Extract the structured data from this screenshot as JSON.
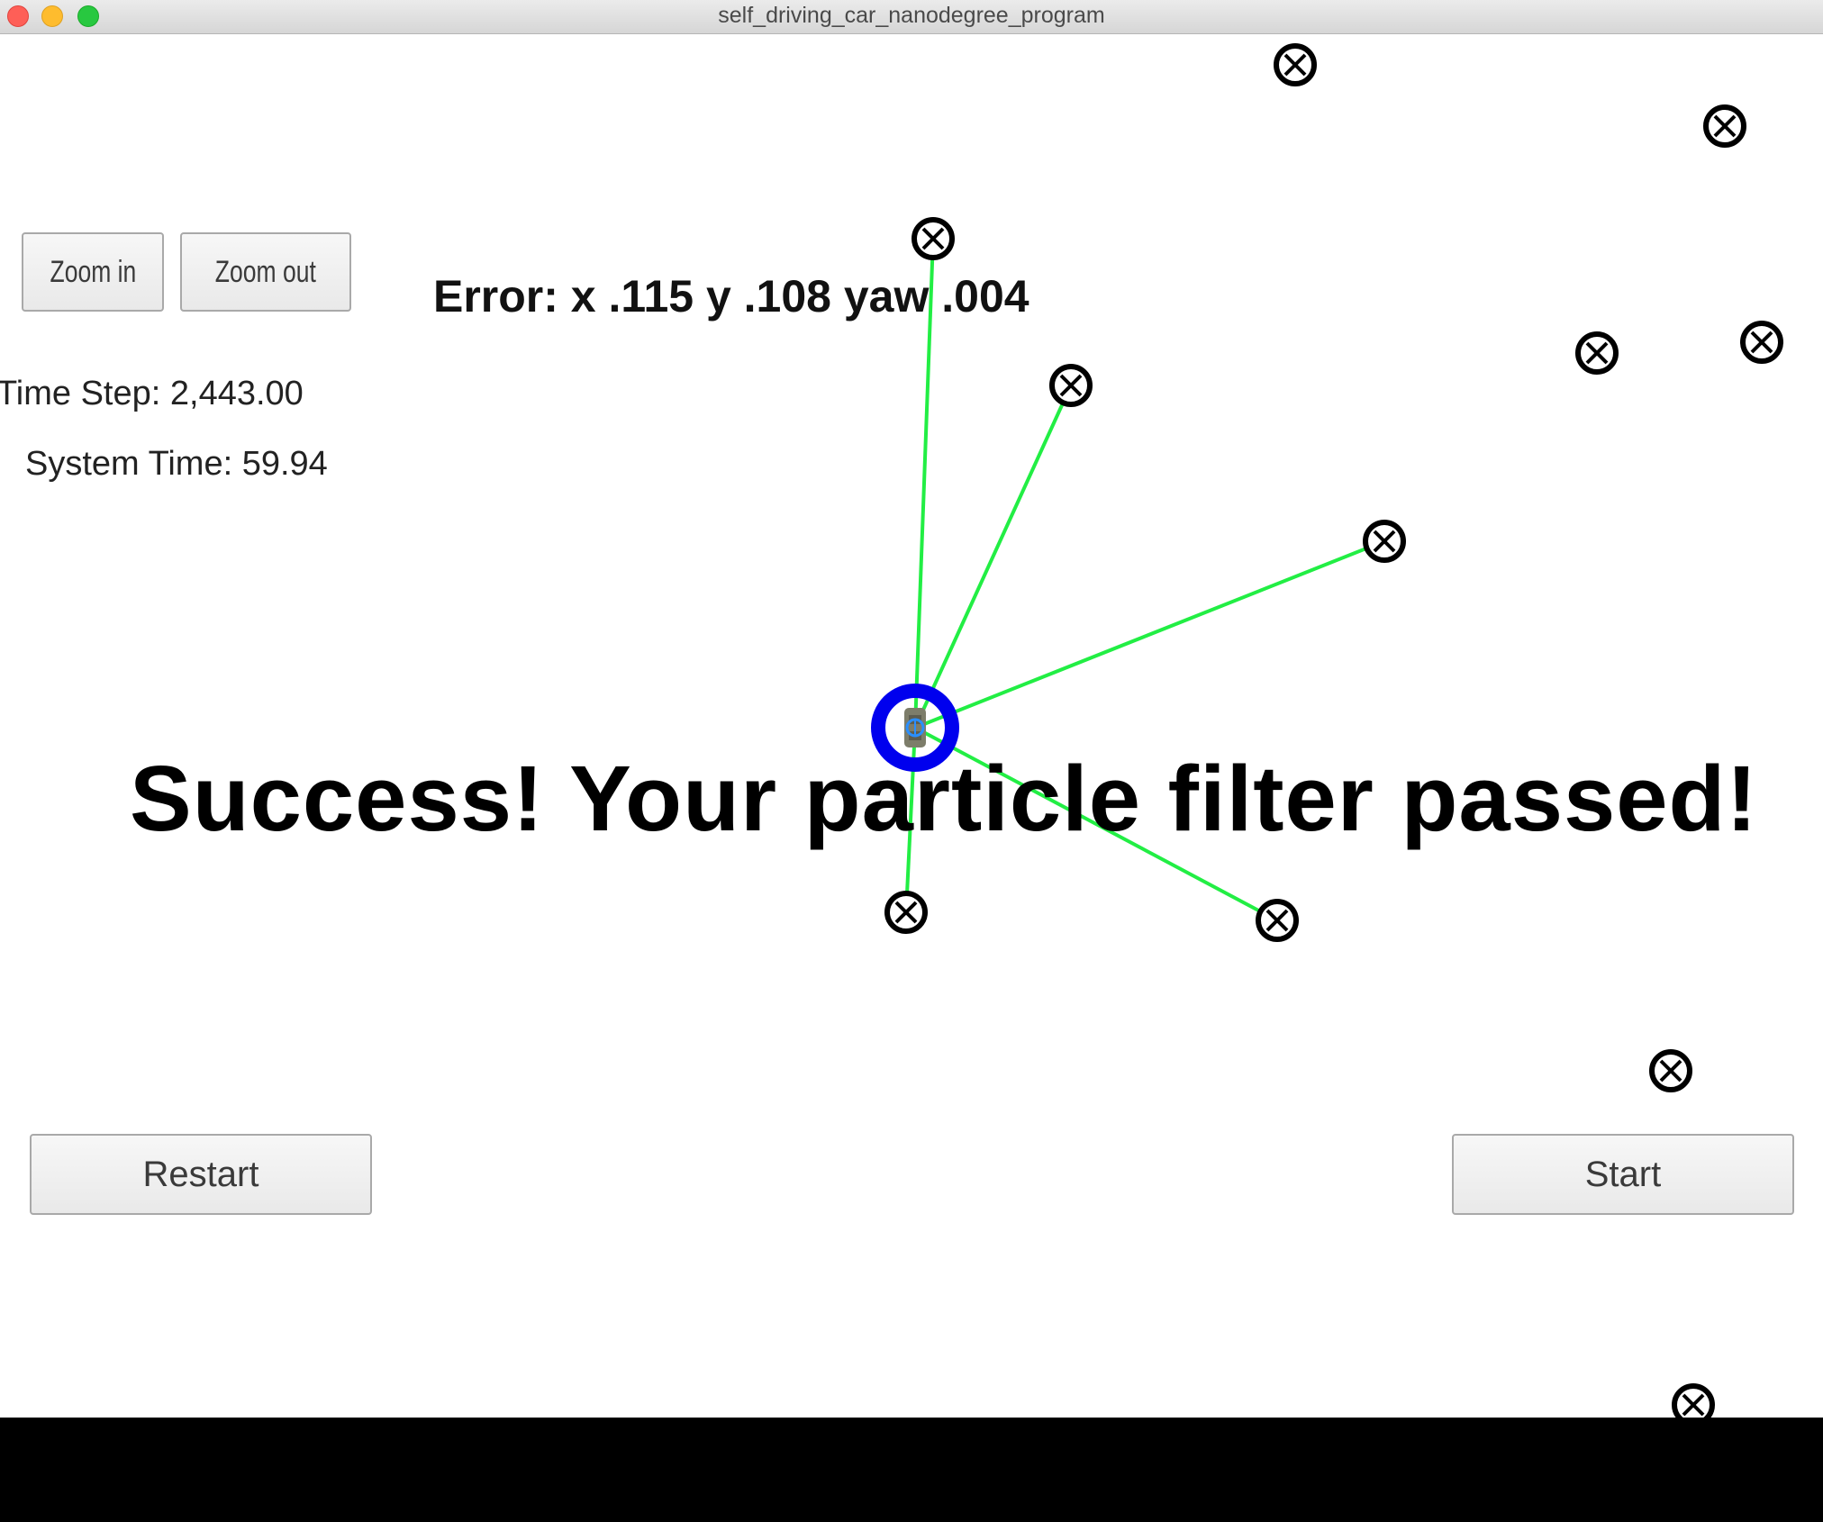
{
  "window": {
    "title": "self_driving_car_nanodegree_program"
  },
  "controls": {
    "zoom_in_label": "Zoom in",
    "zoom_out_label": "Zoom out",
    "restart_label": "Restart",
    "start_label": "Start"
  },
  "stats": {
    "time_step": "Time Step: 2,443.00",
    "system_time": "System Time: 59.94"
  },
  "error_readout": "Error: x .115 y .108 yaw .004",
  "status_message": "Success! Your particle filter passed!",
  "colors": {
    "observation_line": "#22ee44",
    "vehicle_ring": "#0000ee",
    "landmark": "#000000"
  },
  "icons": {
    "landmark": "landmark-marker-icon",
    "vehicle": "vehicle-marker-icon"
  }
}
